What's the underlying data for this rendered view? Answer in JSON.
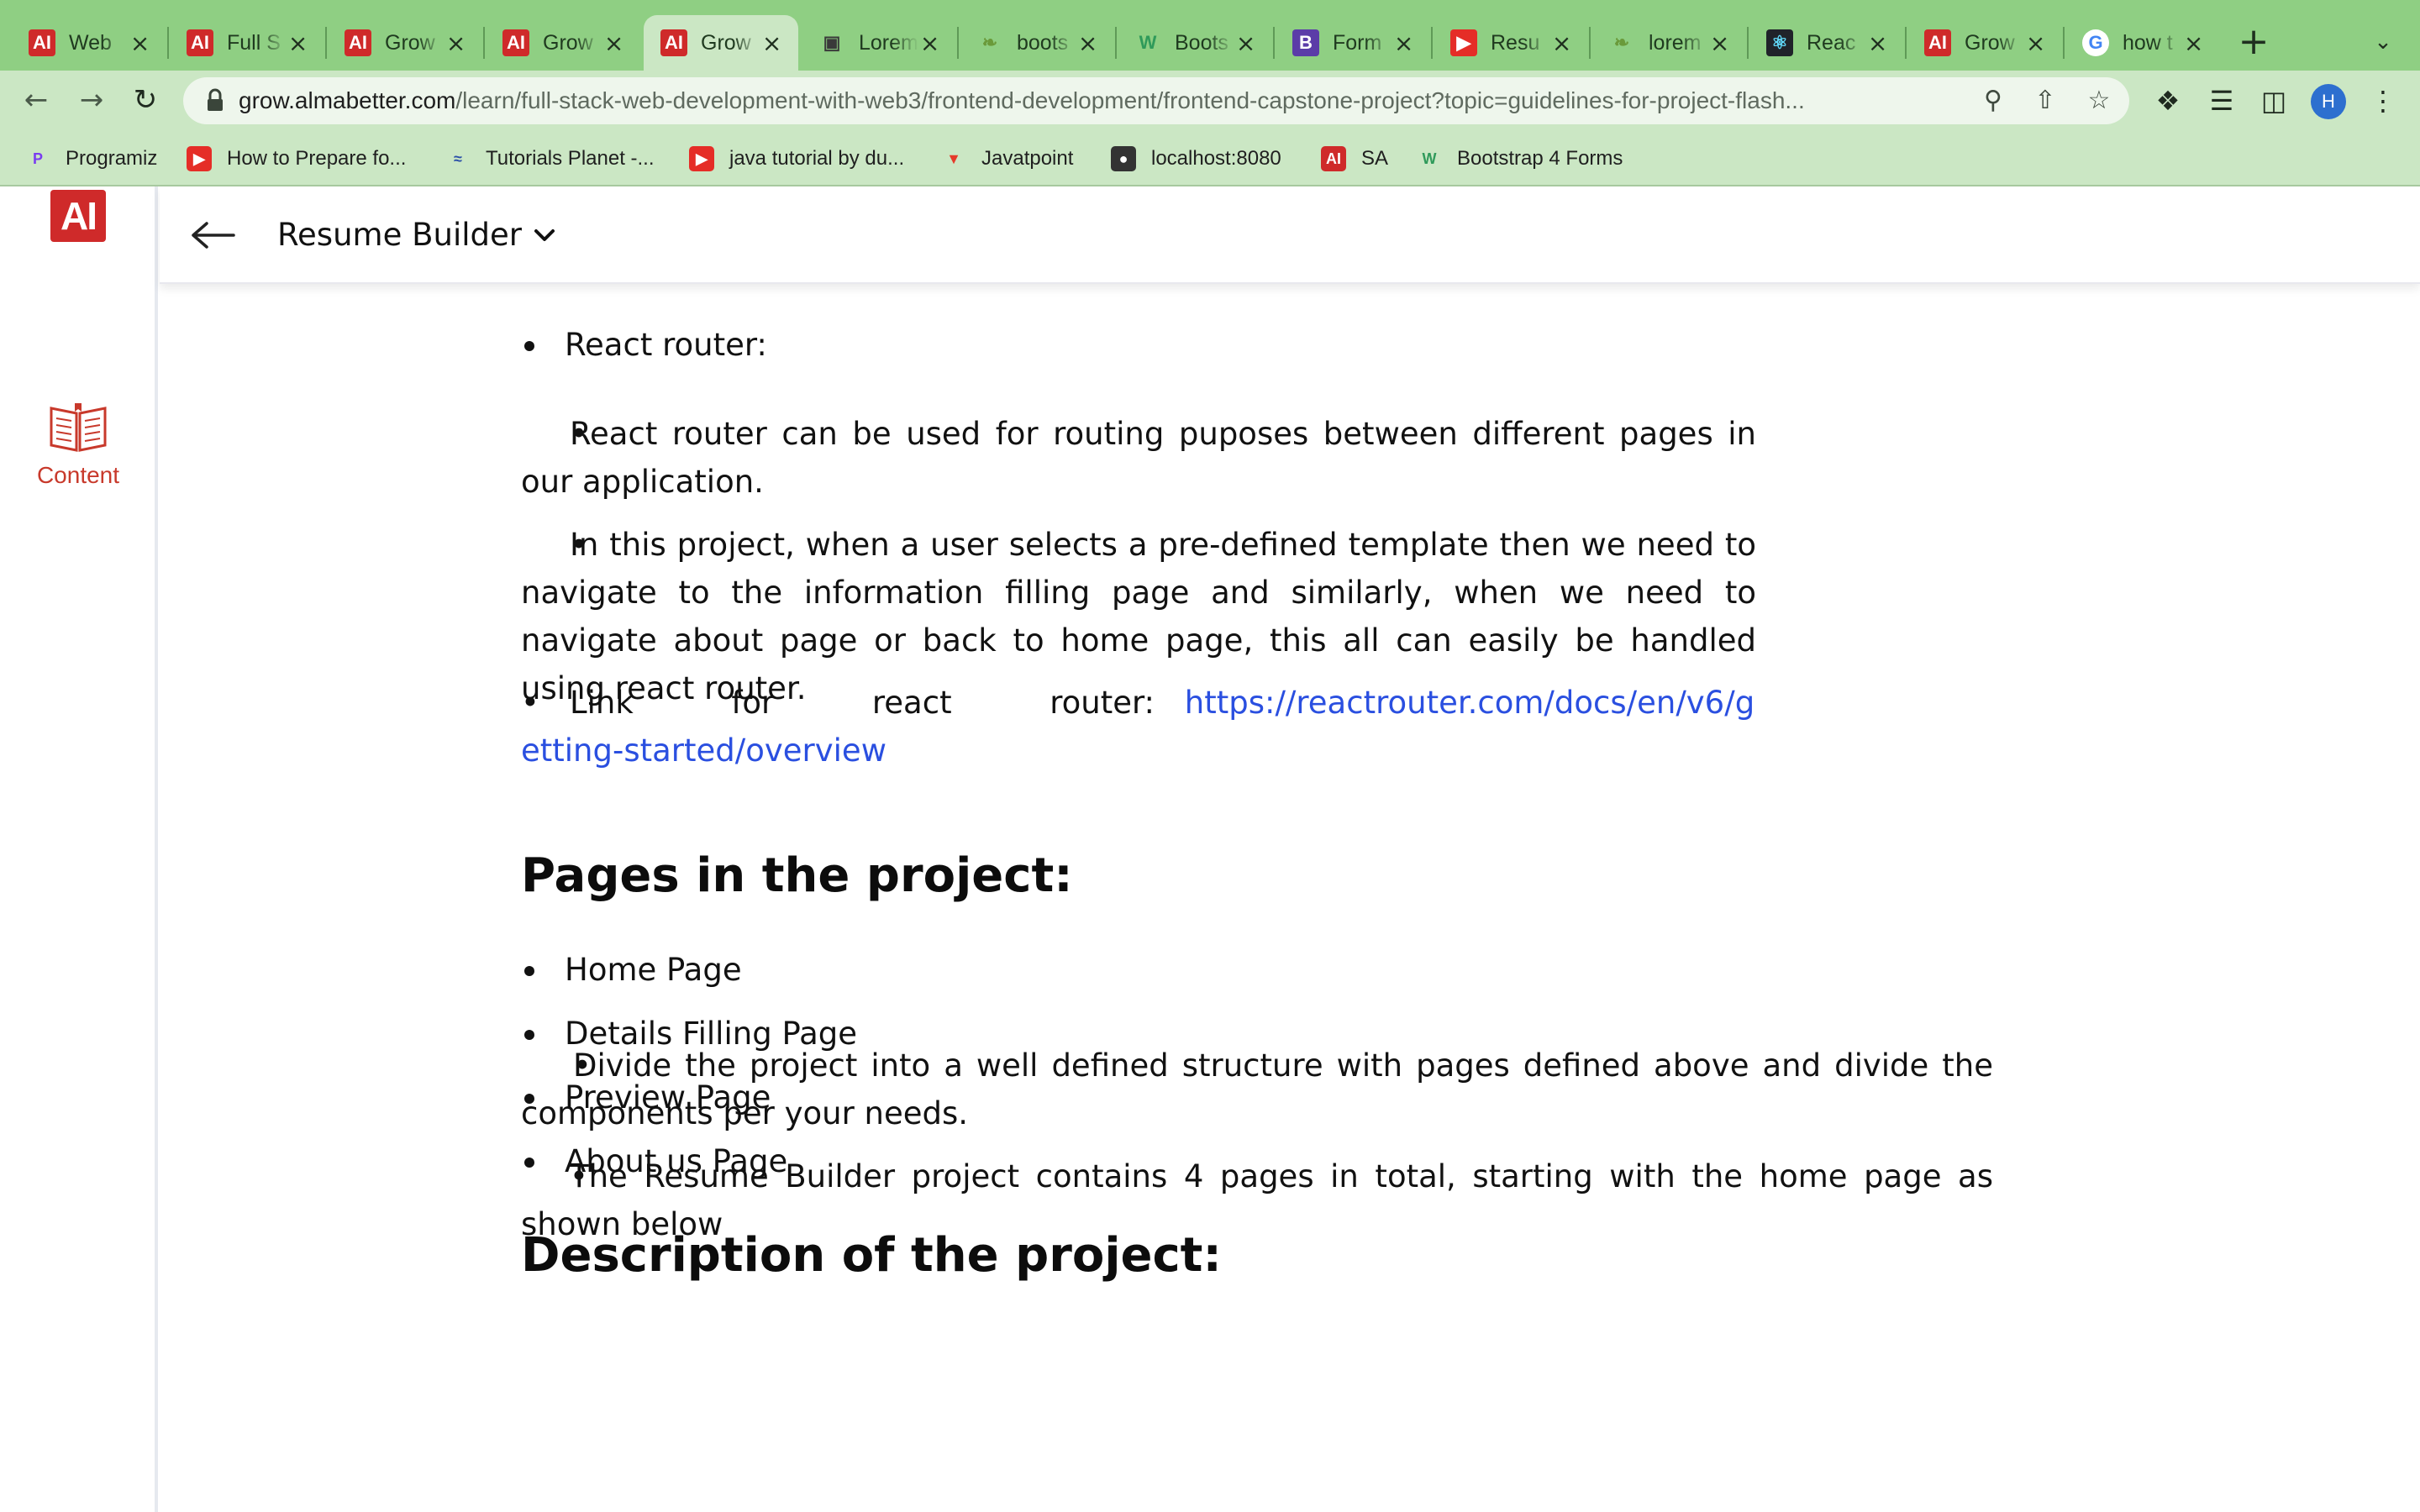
{
  "browser": {
    "tabs": [
      {
        "title": "Web",
        "favicon": "almabetter-icon",
        "color": "#cf2a2a"
      },
      {
        "title": "Full S",
        "favicon": "almabetter-icon",
        "color": "#cf2a2a"
      },
      {
        "title": "Grow",
        "favicon": "almabetter-icon",
        "color": "#cf2a2a"
      },
      {
        "title": "Grow",
        "favicon": "almabetter-icon",
        "color": "#cf2a2a"
      },
      {
        "title": "Grow",
        "favicon": "almabetter-icon",
        "color": "#cf2a2a",
        "active": true
      },
      {
        "title": "Lorem",
        "favicon": "image-icon",
        "color": "#3a3a3a"
      },
      {
        "title": "boots",
        "favicon": "bootstrap-icon",
        "color": "#6a9a3a"
      },
      {
        "title": "Boots",
        "favicon": "w3-icon",
        "color": "#2f9a5a"
      },
      {
        "title": "Form",
        "favicon": "bootstrap-b-icon",
        "color": "#5b3ca8"
      },
      {
        "title": "Resu",
        "favicon": "youtube-icon",
        "color": "#e52d27"
      },
      {
        "title": "lorem",
        "favicon": "leaf-icon",
        "color": "#6a9a3a"
      },
      {
        "title": "Reac",
        "favicon": "react-icon",
        "color": "#20232a"
      },
      {
        "title": "Grow",
        "favicon": "almabetter-icon",
        "color": "#cf2a2a"
      },
      {
        "title": "how t",
        "favicon": "google-icon",
        "color": "#ffffff"
      }
    ],
    "url_host": "grow.almabetter.com",
    "url_path": "/learn/full-stack-web-development-with-web3/frontend-development/frontend-capstone-project?topic=guidelines-for-project-flash...",
    "profile_initial": "H",
    "bookmarks": [
      {
        "label": "Programiz",
        "icon": "programiz-icon"
      },
      {
        "label": "How to Prepare fo...",
        "icon": "youtube-icon"
      },
      {
        "label": "Tutorials Planet -...",
        "icon": "tutorials-planet-icon"
      },
      {
        "label": "java tutorial by du...",
        "icon": "youtube-icon"
      },
      {
        "label": "Javatpoint",
        "icon": "javatpoint-icon"
      },
      {
        "label": "localhost:8080",
        "icon": "globe-icon"
      },
      {
        "label": "SA",
        "icon": "almabetter-icon"
      },
      {
        "label": "Bootstrap 4 Forms",
        "icon": "w3-icon"
      }
    ]
  },
  "app": {
    "logo_text": "AI",
    "sidebar_content_label": "Content",
    "course_title": "Resume Builder"
  },
  "article": {
    "router_heading_item": "React router:",
    "router_p1": "React router can be used for routing puposes between different pages in our application.",
    "router_p2": "In this project, when a user selects a pre-defined template then we need to navigate to the information filling page and similarly, when we need to navigate about page or back to home page, this all can easily be handled using react router.",
    "router_link_label": "Link for react router:",
    "router_link_url": "https://reactrouter.com/docs/en/v6/getting-started/overview",
    "pages_heading": "Pages in the project:",
    "pages": [
      "Home Page",
      "Details Filling Page",
      "Preview Page",
      "About us Page"
    ],
    "desc_heading": "Description of the project:",
    "desc_p1": "Divide the project into a well defined structure with pages defined above and divide the components per your needs.",
    "desc_p2": "The Resume Builder project contains 4 pages in total, starting with the home page as shown below"
  }
}
